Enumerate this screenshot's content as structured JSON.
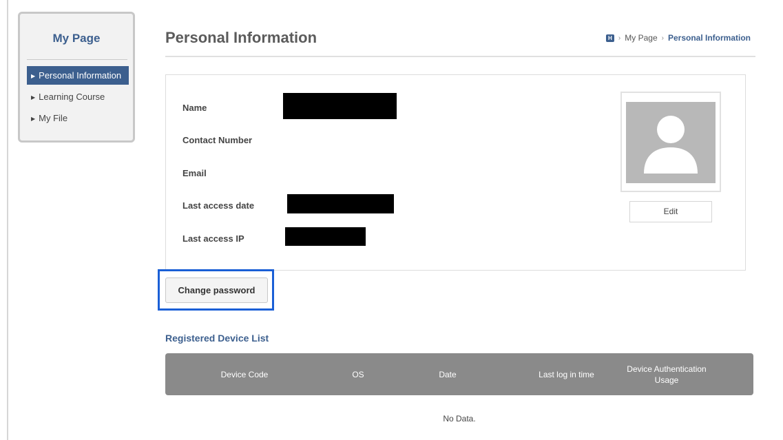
{
  "sidebar": {
    "title": "My Page",
    "items": [
      {
        "label": "Personal Information",
        "active": true
      },
      {
        "label": "Learning Course",
        "active": false
      },
      {
        "label": "My File",
        "active": false
      }
    ]
  },
  "header": {
    "title": "Personal Information",
    "breadcrumb": {
      "home_icon": "H",
      "parent": "My Page",
      "current": "Personal Information"
    }
  },
  "profile": {
    "fields": [
      {
        "label": "Name",
        "redacted": true
      },
      {
        "label": "Contact Number",
        "redacted": false
      },
      {
        "label": "Email",
        "redacted": false
      },
      {
        "label": "Last access date",
        "redacted": true
      },
      {
        "label": "Last access IP",
        "redacted": true
      }
    ],
    "photo_icon": "user-silhouette-icon",
    "edit_label": "Edit"
  },
  "actions": {
    "change_password_label": "Change password",
    "highlight_color": "#1a5fd6"
  },
  "devices": {
    "title": "Registered Device List",
    "columns": [
      "Device Code",
      "OS",
      "Date",
      "Last log in time",
      "Device Authentication Usage"
    ],
    "empty_text": "No Data."
  },
  "colors": {
    "accent": "#3c5f8e",
    "table_header": "#8a8a8a"
  }
}
